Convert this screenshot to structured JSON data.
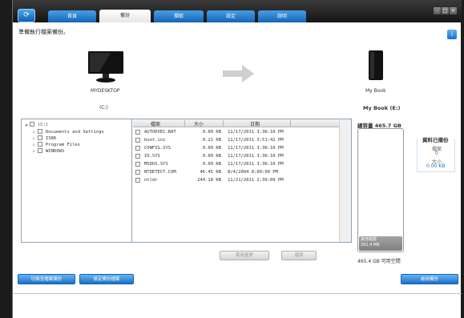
{
  "tabs": [
    {
      "label": "首頁"
    },
    {
      "label": "備份"
    },
    {
      "label": "擷取"
    },
    {
      "label": "設定"
    },
    {
      "label": "說明"
    }
  ],
  "window_controls": {
    "minimize": "-",
    "restore": "□",
    "close": "×"
  },
  "status_text": "準備執行檔案備份。",
  "info_button": "i",
  "source": {
    "name": "MYDESKTOP",
    "drive": "(C:)"
  },
  "destination": {
    "name": "My Book",
    "drive": "My Book (E:)"
  },
  "tree": {
    "root": "(C:)",
    "items": [
      "Documents and Settings",
      "I386",
      "Program Files",
      "WINDOWS"
    ]
  },
  "file_list": {
    "columns": {
      "name": "檔案",
      "size": "大小",
      "date": "日期"
    },
    "rows": [
      {
        "name": "AUTOEXEC.BAT",
        "size": "0.00 KB",
        "date": "11/17/2011 3:36:10 PM"
      },
      {
        "name": "boot.ini",
        "size": "0.21 KB",
        "date": "11/17/2011 3:51:42 PM"
      },
      {
        "name": "CONFIG.SYS",
        "size": "0.00 KB",
        "date": "11/17/2011 3:36:10 PM"
      },
      {
        "name": "IO.SYS",
        "size": "0.00 KB",
        "date": "11/17/2011 3:36:10 PM"
      },
      {
        "name": "MSDOS.SYS",
        "size": "0.00 KB",
        "date": "11/17/2011 3:36:10 PM"
      },
      {
        "name": "NTDETECT.COM",
        "size": "46.45 KB",
        "date": "8/4/2004 8:00:00 PM"
      },
      {
        "name": "ntldr",
        "size": "244.18 KB",
        "date": "11/21/2011 2:30:09 PM"
      }
    ]
  },
  "apply_button": "套用變更",
  "cancel_button": "還原",
  "capacity": {
    "total_label": "總容量",
    "total_value": "465.7 GB",
    "other_label": "其他檔案",
    "other_value": "291.4 MB",
    "free_text": "465.4 GB 可用空間"
  },
  "backed_up": {
    "title": "資料已備份",
    "files_label": "檔案",
    "files_value": "0",
    "size_label": "大小",
    "size_value": "0.00 KB"
  },
  "bottom_buttons": {
    "switch": "切換至檔案備份",
    "settings": "設定備份檔案",
    "start": "啟用備份"
  },
  "colors": {
    "accent": "#1c6fc6",
    "titlebar": "#1f1f1f"
  }
}
